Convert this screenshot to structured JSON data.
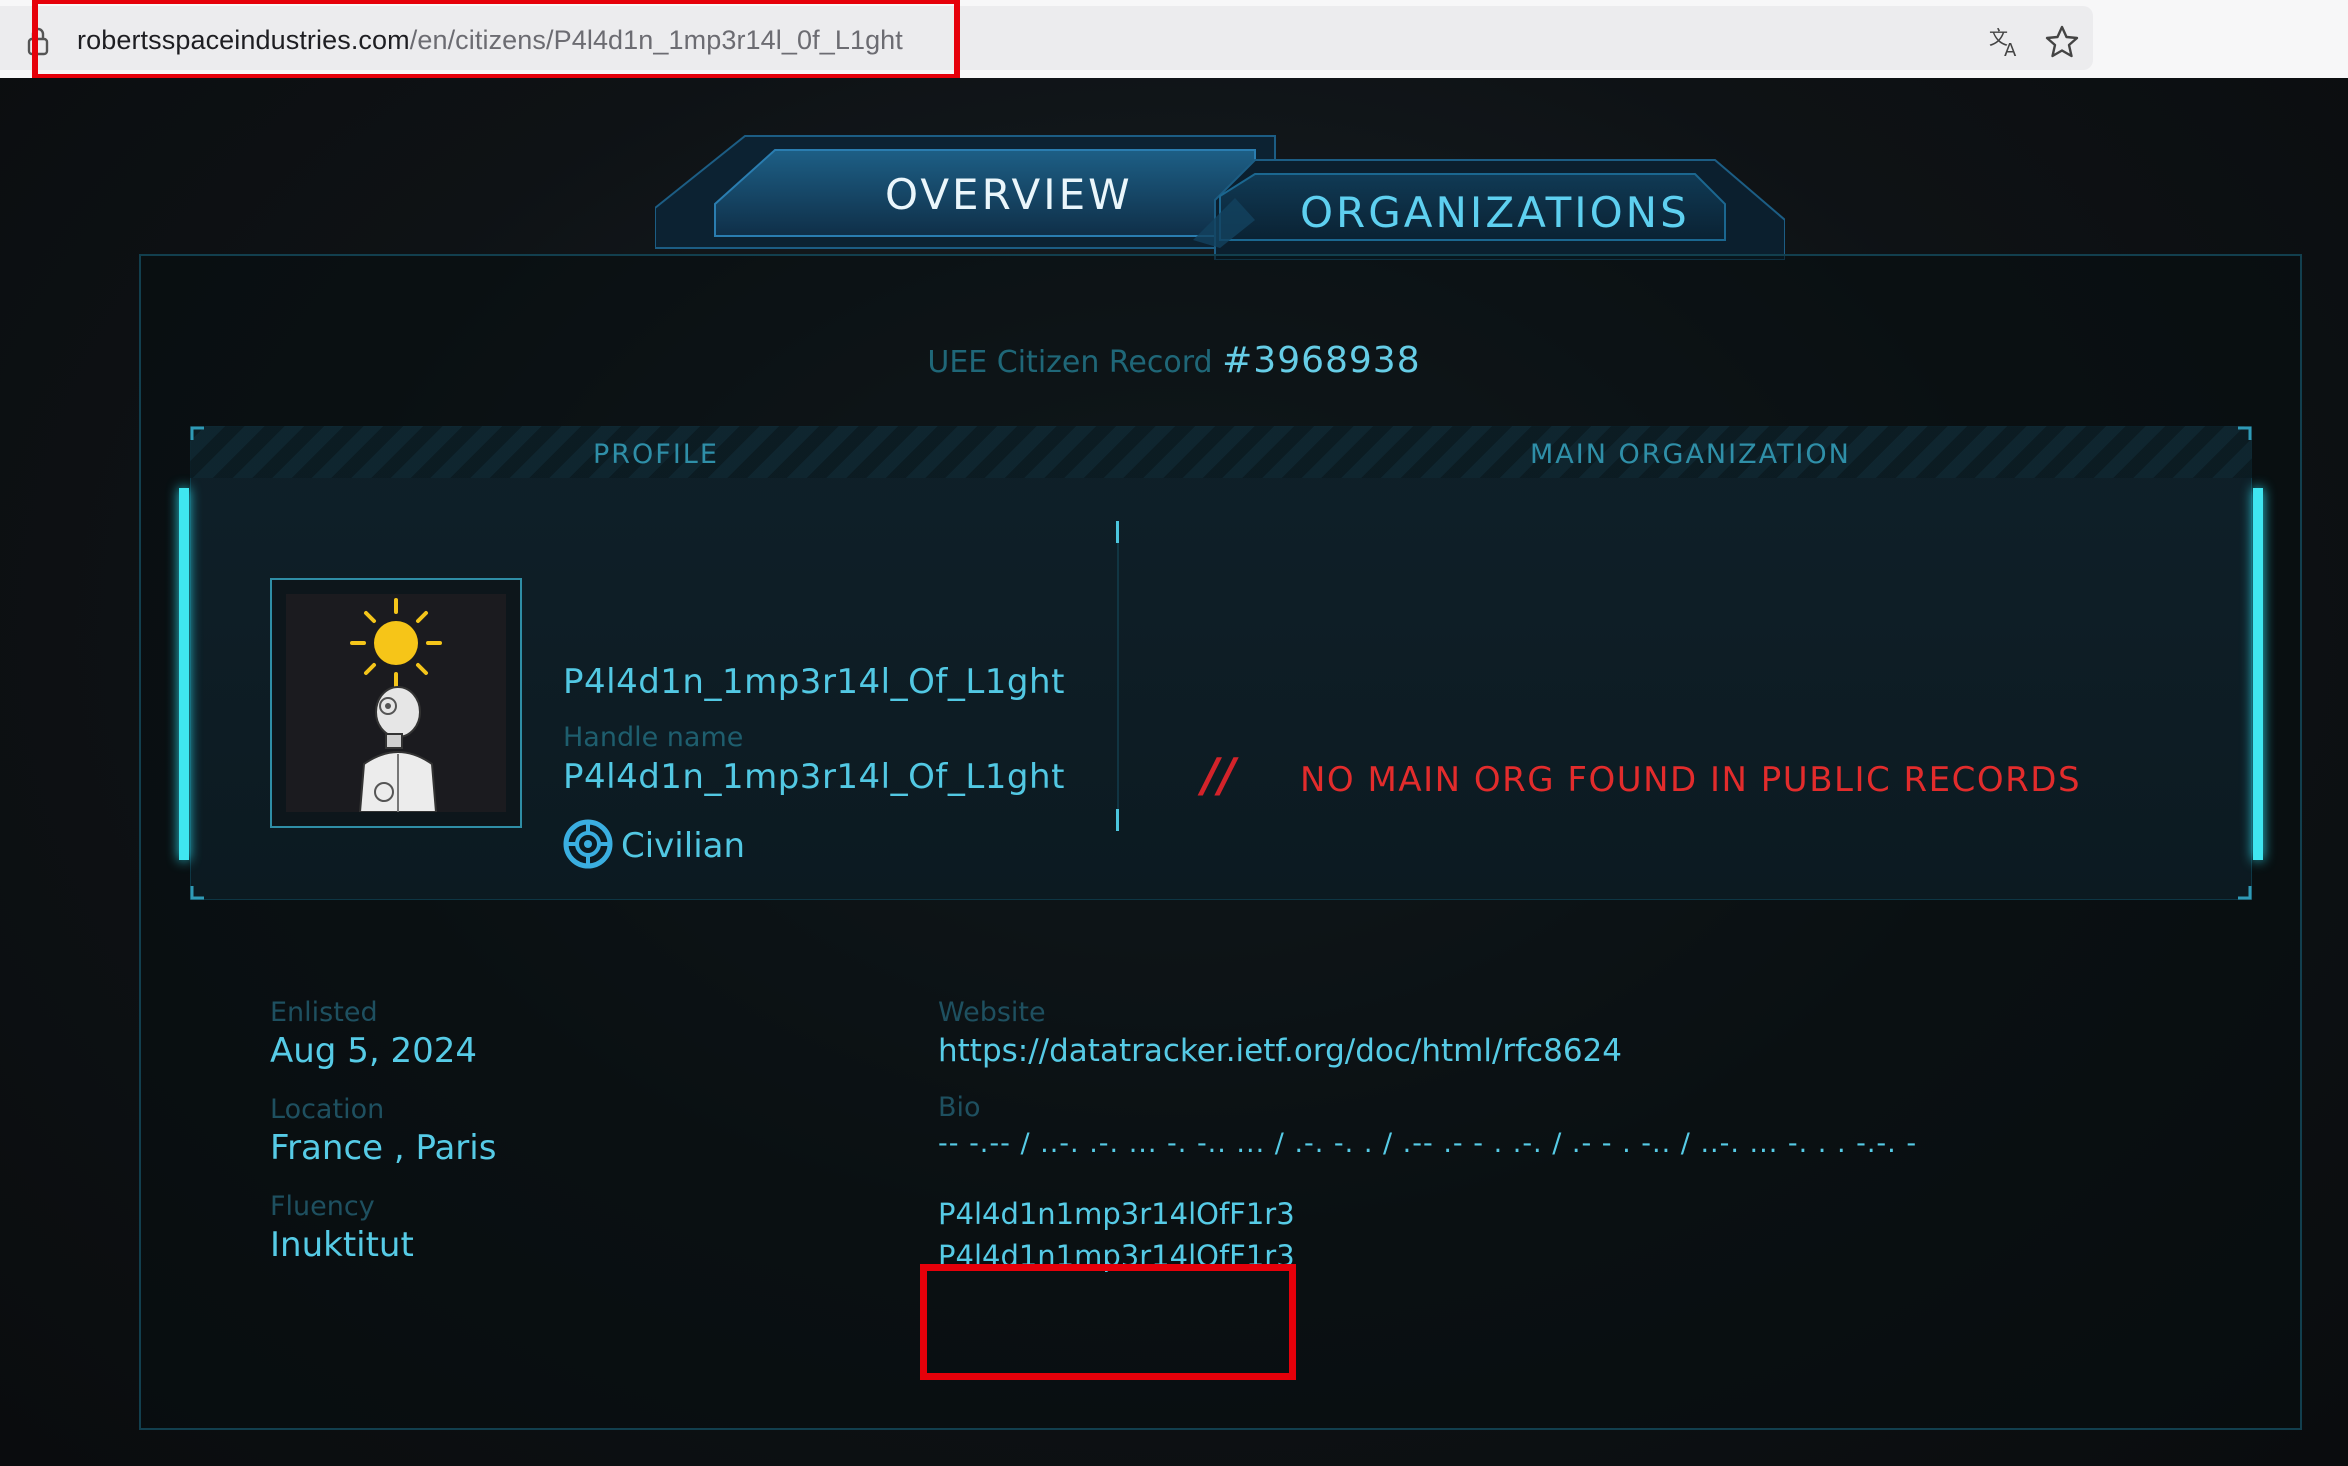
{
  "browser": {
    "url_domain": "robertsspaceindustries.com",
    "url_path": "/en/citizens/P4l4d1n_1mp3r14l_0f_L1ght",
    "icons": [
      "lock-icon",
      "translate-icon",
      "bookmark-star-icon"
    ]
  },
  "tabs": [
    {
      "label": "OVERVIEW",
      "active": true
    },
    {
      "label": "ORGANIZATIONS",
      "active": false
    }
  ],
  "record": {
    "prefix": "UEE Citizen Record",
    "number": "#3968938"
  },
  "profile": {
    "header": "PROFILE",
    "display_name": "P4l4d1n_1mp3r14l_Of_L1ght",
    "handle_label": "Handle name",
    "handle": "P4l4d1n_1mp3r14l_Of_L1ght",
    "rank": "Civilian",
    "avatar_icon": "robot-with-sun-avatar"
  },
  "main_org": {
    "header": "MAIN ORGANIZATION",
    "slashes": "//",
    "message": "NO MAIN ORG FOUND IN PUBLIC RECORDS"
  },
  "details": {
    "enlisted_label": "Enlisted",
    "enlisted": "Aug 5, 2024",
    "location_label": "Location",
    "location": "France , Paris",
    "fluency_label": "Fluency",
    "fluency": "Inuktitut",
    "website_label": "Website",
    "website": "https://datatracker.ietf.org/doc/html/rfc8624",
    "bio_label": "Bio",
    "bio_line1": "-- -.-- / ..-. .-. ... -. -.. ... / .-. -. . / .-- .- - . .-. / .- - . -.. / ..-. ... -. . . -.-. -",
    "bio_line2": "P4l4d1n1mp3r14lOfF1r3",
    "bio_line3": "P4l4d1n1mp3r14lOfF1r3"
  },
  "colors": {
    "accent": "#56cbe6",
    "warning": "#e22c2c",
    "highlight_box": "#e6000a",
    "panel_edge": "#3fe6f0"
  }
}
